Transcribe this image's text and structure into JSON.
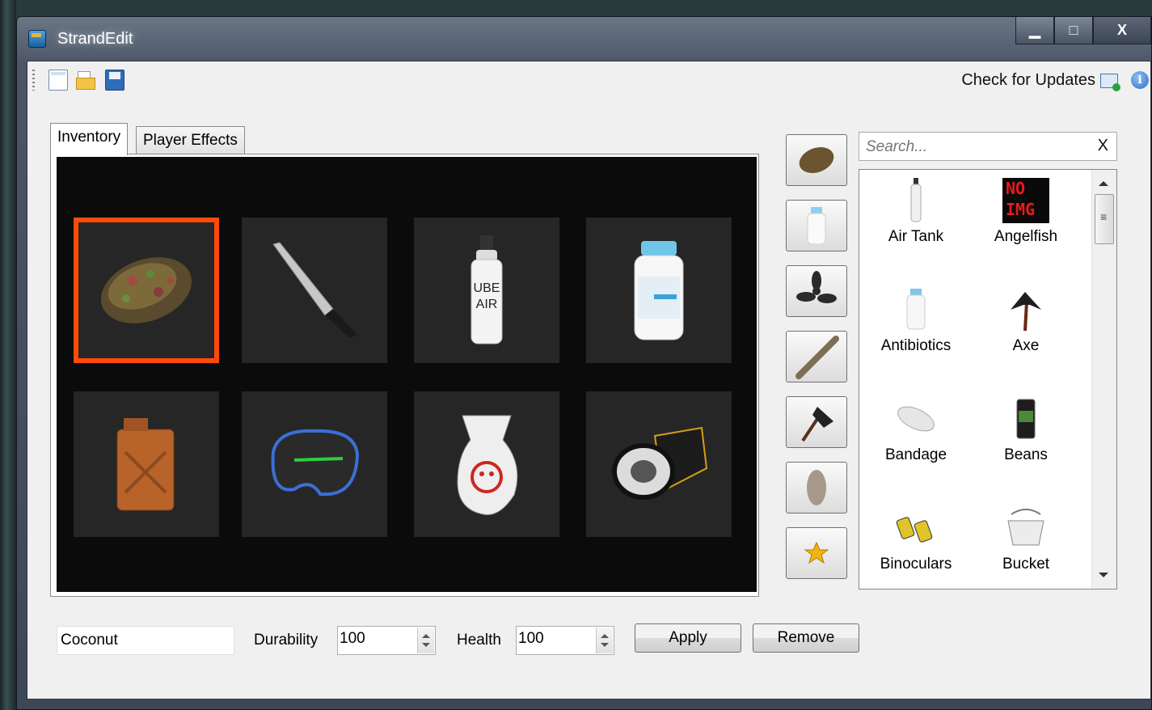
{
  "window": {
    "title": "StrandEdit",
    "caption": {
      "minimize": "▁",
      "maximize": "□",
      "close": "X"
    }
  },
  "toolbar": {
    "updates_label": "Check for Updates"
  },
  "tabs": [
    {
      "label": "Inventory",
      "active": true
    },
    {
      "label": "Player Effects",
      "active": false
    }
  ],
  "inventory": {
    "slots": [
      {
        "item": "coconut",
        "selected": true
      },
      {
        "item": "knife",
        "selected": false
      },
      {
        "item": "air-tank",
        "selected": false
      },
      {
        "item": "antibiotics",
        "selected": false
      },
      {
        "item": "fuel-can",
        "selected": false
      },
      {
        "item": "goggles",
        "selected": false
      },
      {
        "item": "volleyball-sack",
        "selected": false
      },
      {
        "item": "flashlight",
        "selected": false
      }
    ]
  },
  "categories": [
    "food",
    "medical",
    "propeller",
    "stick",
    "axe",
    "stone",
    "favorite"
  ],
  "search": {
    "placeholder": "Search...",
    "clear_label": "X"
  },
  "item_list": [
    {
      "label": "Air Tank",
      "icon": "air-tank"
    },
    {
      "label": "Angelfish",
      "icon": "no-img",
      "no_img_text_1": "NO",
      "no_img_text_2": "IMG"
    },
    {
      "label": "Antibiotics",
      "icon": "antibiotics"
    },
    {
      "label": "Axe",
      "icon": "axe"
    },
    {
      "label": "Bandage",
      "icon": "bandage"
    },
    {
      "label": "Beans",
      "icon": "beans"
    },
    {
      "label": "Binoculars",
      "icon": "binoculars"
    },
    {
      "label": "Bucket",
      "icon": "bucket"
    }
  ],
  "editor": {
    "name_value": "Coconut",
    "durability_label": "Durability",
    "durability_value": "100",
    "health_label": "Health",
    "health_value": "100",
    "apply_label": "Apply",
    "remove_label": "Remove"
  },
  "colors": {
    "selection": "#ff4b0a",
    "inventory_bg": "#0b0b0b",
    "slot_bg": "#262626"
  }
}
